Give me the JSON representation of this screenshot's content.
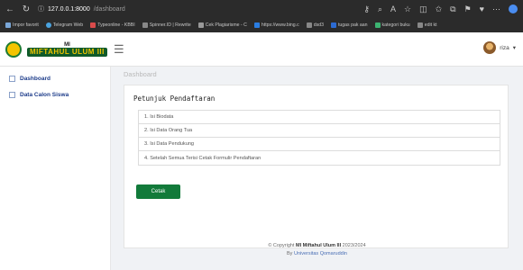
{
  "browser": {
    "host": "127.0.0.1:8000",
    "path": "/dashboard",
    "bookmarks": [
      {
        "label": "Impor favorit",
        "color": "#7aa7d8"
      },
      {
        "label": "Telegram Web",
        "color": "#4aa3df"
      },
      {
        "label": "Typeonline - KBBI",
        "color": "#d94b4b"
      },
      {
        "label": "Spinner.ID | Rewrite",
        "color": "#888888"
      },
      {
        "label": "Cek Plagiarisme - C",
        "color": "#999999"
      },
      {
        "label": "https://www.bing.c",
        "color": "#2a7de1"
      },
      {
        "label": "dsd3",
        "color": "#888888"
      },
      {
        "label": "tugas pak aan",
        "color": "#2c6bd3"
      },
      {
        "label": "kategori buku",
        "color": "#3cb371"
      },
      {
        "label": "edit kt",
        "color": "#888888"
      }
    ]
  },
  "header": {
    "logo_top": "MI",
    "logo_bottom": "MIFTAHUL ULUM III",
    "user_name": "riza"
  },
  "sidebar": {
    "items": [
      {
        "label": "Dashboard"
      },
      {
        "label": "Data Calon Siswa"
      }
    ]
  },
  "main": {
    "breadcrumb": "Dashboard",
    "card_title": "Petunjuk Pendaftaran",
    "steps": [
      "1. Isi Biodata",
      "2. Isi Data Orang Tua",
      "3. Isi Data Pendukung",
      "4. Setelah Semua Terisi Cetak Formulir Pendaftaran"
    ],
    "print_button": "Cetak"
  },
  "footer": {
    "copyright_prefix": "© Copyright",
    "school": "MI Miftahul Ulum III",
    "year": "2023/2024",
    "by_prefix": "By",
    "by_org": "Universitas Qomaruddin"
  }
}
